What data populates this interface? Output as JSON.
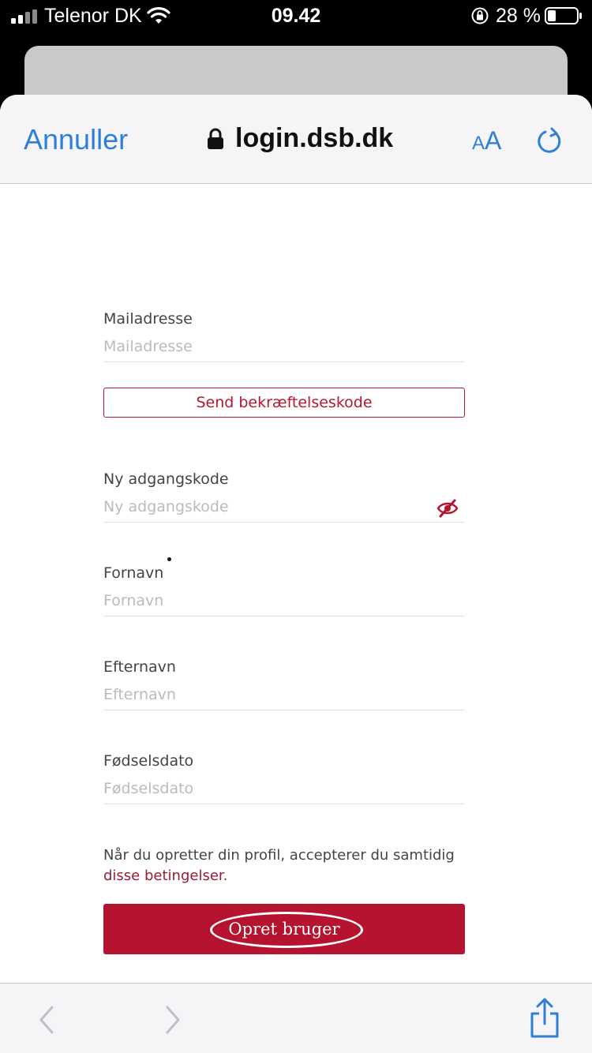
{
  "status_bar": {
    "carrier": "Telenor DK",
    "time": "09.42",
    "battery": "28 %"
  },
  "nav": {
    "cancel": "Annuller",
    "url": "login.dsb.dk",
    "text_size_small": "A",
    "text_size_big": "A",
    "accent_color": "#2f7fd6"
  },
  "form": {
    "email": {
      "label": "Mailadresse",
      "placeholder": "Mailadresse",
      "value": ""
    },
    "send_code_button": "Send bekræftelseskode",
    "new_password": {
      "label": "Ny adgangskode",
      "placeholder": "Ny adgangskode",
      "value": ""
    },
    "first_name": {
      "label": "Fornavn",
      "placeholder": "Fornavn",
      "value": ""
    },
    "last_name": {
      "label": "Efternavn",
      "placeholder": "Efternavn",
      "value": ""
    },
    "birthdate": {
      "label": "Fødselsdato",
      "placeholder": "Fødselsdato",
      "value": ""
    },
    "terms_text": "Når du opretter din profil, accepterer du samtidig",
    "terms_link": "disse betingelser",
    "terms_end": ".",
    "create_button": "Opret bruger",
    "brand_color": "#b5132f"
  },
  "toolbar": {
    "icons": [
      "chevron-left-icon",
      "chevron-right-icon",
      "share-icon"
    ]
  }
}
